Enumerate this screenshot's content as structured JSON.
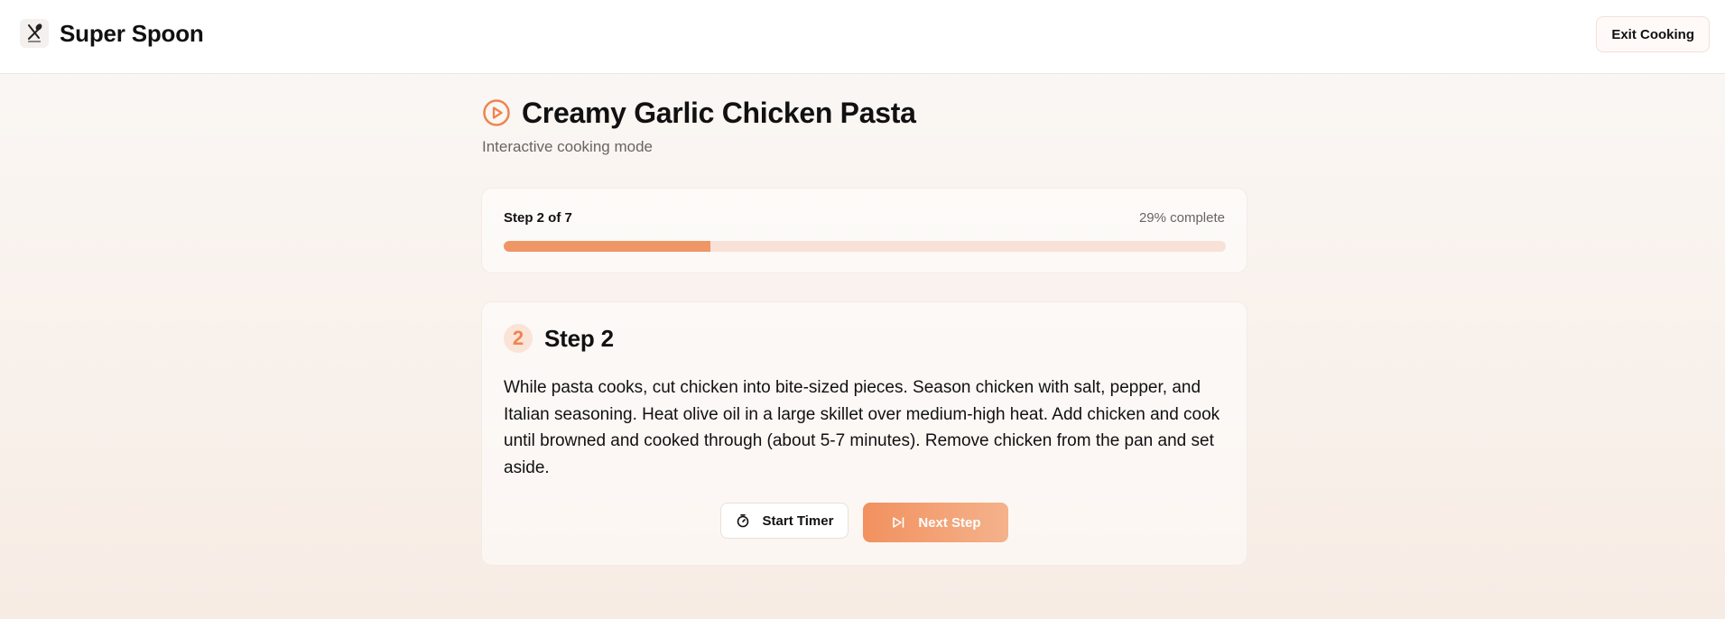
{
  "app": {
    "name": "Super Spoon",
    "logo_icon": "fork-spoon-icon"
  },
  "header": {
    "exit_label": "Exit Cooking"
  },
  "recipe": {
    "title": "Creamy Garlic Chicken Pasta",
    "subtitle": "Interactive cooking mode",
    "title_icon": "play-circle-icon"
  },
  "progress": {
    "label": "Step 2 of 7",
    "percent_label": "29% complete",
    "fraction": 0.286
  },
  "step": {
    "number": "2",
    "title": "Step 2",
    "instructions": "While pasta cooks, cut chicken into bite-sized pieces. Season chicken with salt, pepper, and Italian seasoning. Heat olive oil in a large skillet over medium-high heat. Add chicken and cook until browned and cooked through (about 5-7 minutes). Remove chicken from the pan and set aside."
  },
  "actions": {
    "timer_label": "Start Timer",
    "timer_icon": "stopwatch-icon",
    "next_label": "Next Step",
    "next_icon": "skip-forward-icon"
  },
  "colors": {
    "accent": "#f09565",
    "accent_light": "#f8e2d7"
  }
}
